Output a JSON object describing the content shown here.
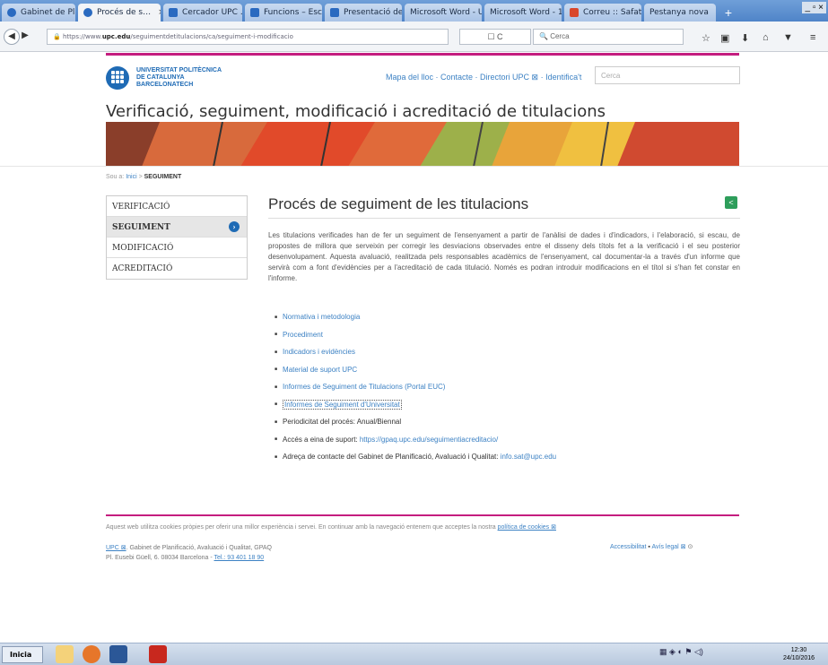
{
  "browser": {
    "tabs": [
      {
        "label": "Gabinet de Plani…",
        "active": false,
        "icon": "upc-favicon"
      },
      {
        "label": "Procés de s…",
        "active": true,
        "icon": "upc-favicon"
      },
      {
        "label": "Cercador UPC …",
        "active": false,
        "icon": "doc-favicon"
      },
      {
        "label": "Funcions – Esc…",
        "active": false,
        "icon": "doc-favicon"
      },
      {
        "label": "Presentació del …",
        "active": false,
        "icon": "doc-favicon"
      },
      {
        "label": "Microsoft Word - UP…",
        "active": false,
        "icon": "doc-favicon"
      },
      {
        "label": "Microsoft Word - 15…",
        "active": false,
        "icon": "doc-favicon"
      },
      {
        "label": "Correu :: Safat…",
        "active": false,
        "icon": "mail-favicon"
      },
      {
        "label": "Pestanya nova",
        "active": false,
        "icon": "none"
      }
    ],
    "tab_close": "×",
    "new_tab": "+",
    "window_controls": "_ ▫ ×",
    "url_prefix": "https://www.",
    "url_domain": "upc.edu",
    "url_path": "/seguimentdetitulacions/ca/seguiment-i-modificacio",
    "search_placeholder": "Cerca",
    "url_buttons": "☐  C"
  },
  "header": {
    "logo_line1": "UNIVERSITAT POLITÈCNICA",
    "logo_line2": "DE CATALUNYA",
    "logo_line3": "BARCELONATECH",
    "links": "Mapa del lloc · Contacte · Directori UPC ⊠ · Identifica't",
    "search_placeholder": "Cerca",
    "site_title": "Verificació, seguiment, modificació i acreditació de titulacions"
  },
  "breadcrumb": {
    "prefix": "Sou a:",
    "home": "Inici",
    "sep": " > ",
    "current": "SEGUIMENT"
  },
  "sidenav": [
    {
      "label": "VERIFICACIÓ",
      "active": false
    },
    {
      "label": "SEGUIMENT",
      "active": true
    },
    {
      "label": "MODIFICACIÓ",
      "active": false
    },
    {
      "label": "ACREDITACIÓ",
      "active": false
    }
  ],
  "main": {
    "title": "Procés de seguiment de les titulacions",
    "intro": "Les titulacions verificades han de fer un seguiment de l'ensenyament a partir de l'anàlisi de dades i d'indicadors, i l'elaboració, si escau, de propostes de millora que serveixin per corregir les desviacions observades entre el disseny dels títols fet a la verificació i el seu posterior desenvolupament. Aquesta avaluació, realitzada pels responsables acadèmics de l'ensenyament, cal documentar-la a través d'un informe que servirà com a font d'evidències per a l'acreditació de cada titulació. Només es podran introduir modificacions en el títol si s'han fet constar en l'informe.",
    "links": [
      "Normativa i metodologia",
      "Procediment",
      "Indicadors i evidències",
      "Material de suport UPC",
      "Informes de Seguiment de Titulacions (Portal EUC)",
      "Informes de Seguiment d'Universitat"
    ],
    "periodicity": "Periodicitat del procés: Anual/Biennal",
    "tool_label": "Accés a eina de suport: ",
    "tool_link": "https://gpaq.upc.edu/seguimentiacreditacio/",
    "contact_label": "Adreça de contacte del Gabinet de Planificació, Avaluació i Qualitat: ",
    "contact_link": "info.sat@upc.edu"
  },
  "footer": {
    "cookies_text": "Aquest web utilitza cookies pròpies per oferir una millor experiència i servei. En continuar amb la navegació entenem que acceptes la nostra ",
    "cookies_link": "política de cookies ⊠",
    "org_link": "UPC ⊠",
    "org_text": ". Gabinet de Planificació, Avaluació i Qualitat, GPAQ",
    "address": "Pl. Eusebi Güell, 6. 08034 Barcelona - ",
    "phone": "Tel.: 93 401 18 90",
    "accessibility": "Accessibilitat",
    "legal": "Avís legal ⊠"
  },
  "taskbar": {
    "start": "Inicia",
    "time": "12:30",
    "date": "24/10/2016"
  }
}
